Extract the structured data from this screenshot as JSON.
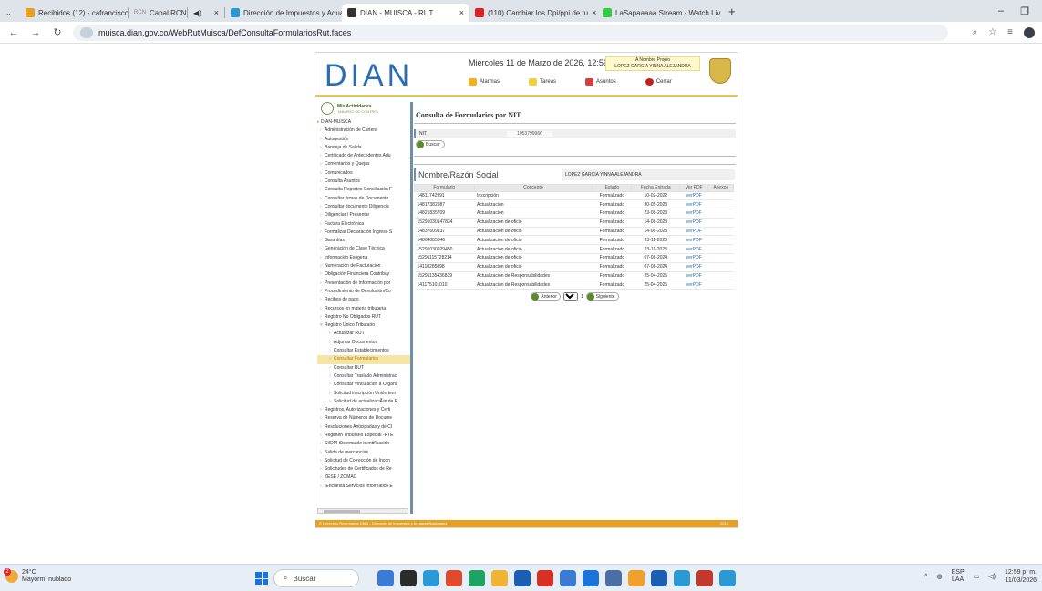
{
  "browser": {
    "tabs": [
      {
        "label": "Recibidos (12) - cafrancisco145",
        "color": "#e8a020",
        "active": false
      },
      {
        "label": "Canal RCN",
        "color": "#e0e0e0",
        "active": false
      },
      {
        "label": "",
        "color": "#e0e0e0",
        "active": false
      },
      {
        "label": "Dirección de Impuestos y Adua",
        "color": "#2a9ad6",
        "active": false
      },
      {
        "label": "DIAN - MUISCA - RUT",
        "color": "#333333",
        "active": true
      },
      {
        "label": "(110) Cambiar los Dpi/ppi de tu",
        "color": "#e02020",
        "active": false
      },
      {
        "label": "LaSapaaaaa Stream - Watch Liv",
        "color": "#2ecc40",
        "active": false
      }
    ],
    "rcn_prefix": "RCN",
    "url": "muisca.dian.gov.co/WebRutMuisca/DefConsultaFormulariosRut.faces"
  },
  "header": {
    "logo": "DIAN",
    "date": "Miércoles 11 de Marzo de 2026, 12:59:29",
    "user_title": "A Nombre Propio",
    "user_name": "LOPEZ GARCIA YINNA ALEJANDRA",
    "links": [
      {
        "label": "Alarmas",
        "color": "#f0b020"
      },
      {
        "label": "Tareas",
        "color": "#f0d040"
      },
      {
        "label": "Asuntos",
        "color": "#d04040"
      },
      {
        "label": "Cerrar",
        "color": "#c02020"
      }
    ]
  },
  "sidebar": {
    "title": "Mis Actividades",
    "subtitle": "TABLERO DE CONTROL",
    "root": "DIAN-MUISCA",
    "items": [
      "Administración de Cartera",
      "Autogestión",
      "Bandeja de Salida",
      "Certificado de Antecedentes Adu",
      "Comentarios y Quejas",
      "Comunicados",
      "Consulta Asuntos",
      "Consulta Reportes Conciliación F",
      "Consultar firmas de Documento",
      "Consultar documento Diligencia",
      "Diligenciar / Presentar",
      "Factura Electrónica",
      "Formalizar Declaración Ingreso S",
      "Garantías",
      "Generación de Clave Técnica",
      "Información Exógena",
      "Numeración de Facturación",
      "Obligación Financiera Contribuy",
      "Presentación de Información por",
      "Procedimiento de Devolución/Co",
      "Recibos de pago",
      "Recursos en materia tributaria",
      "Registro No Obligados RUT"
    ],
    "open_item": "Registro Único Tributario",
    "sub_items": [
      "Actualizar RUT",
      "Adjuntar Documentos",
      "Consultar Establecimientos",
      "Consultar Formularios",
      "Consultar RUT",
      "Consultar Traslado Administrac",
      "Consultar Vinculación a Organi",
      "Solicitud inscripción Unión tem",
      "Solicitud de actualizaciÃ³n de R"
    ],
    "highlighted": "Consultar Formularios",
    "items_after": [
      "Registros, Autorizaciones y Certi",
      "Reserva de Números de Docume",
      "Resoluciones Anticipadas y de Cl",
      "Régimen Tributario Especial -RTE",
      "SIIDPI Sistema de identificación",
      "Salida de mercancías",
      "Solicitud de Corrección de Incon",
      "Solicitudes de Certificados de Re",
      "ZESE / ZOMAC",
      "[Encuesta Servicios Informático E"
    ]
  },
  "main": {
    "title": "Consulta de Formularios por NIT",
    "nit_label": "NIT",
    "nit_value": "1053799966",
    "button_label": "Buscar",
    "rs_label": "Nombre/Razón Social",
    "rs_value": "LOPEZ GARCIA YINNA ALEJANDRA",
    "columns": [
      "Formulario",
      "Concepto",
      "Estado",
      "Fecha Entrada",
      "Ver PDF",
      "Anexos"
    ],
    "rows": [
      [
        "14811742991",
        "Inscripción",
        "Formalizado",
        "10-02-2022",
        "verPDF",
        ""
      ],
      [
        "14817382987",
        "Actualización",
        "Formalizado",
        "30-05-2023",
        "verPDF",
        ""
      ],
      [
        "14821835709",
        "Actualización",
        "Formalizado",
        "23-08-2023",
        "verPDF",
        ""
      ],
      [
        "15291030147834",
        "Actualización de oficio",
        "Formalizado",
        "14-08-2023",
        "verPDF",
        ""
      ],
      [
        "14837609137",
        "Actualización de oficio",
        "Formalizado",
        "14-08-2023",
        "verPDF",
        ""
      ],
      [
        "14864085846",
        "Actualización de oficio",
        "Formalizado",
        "23-11-2023",
        "verPDF",
        ""
      ],
      [
        "15291030929450",
        "Actualización de oficio",
        "Formalizado",
        "23-11-2023",
        "verPDF",
        ""
      ],
      [
        "15291115728214",
        "Actualización de oficio",
        "Formalizado",
        "07-08-2024",
        "verPDF",
        ""
      ],
      [
        "14110285898",
        "Actualización de oficio",
        "Formalizado",
        "07-08-2024",
        "verPDF",
        ""
      ],
      [
        "15291135436839",
        "Actualización de Responsabilidades",
        "Formalizado",
        "25-04-2025",
        "verPDF",
        ""
      ],
      [
        "141175101010",
        "Actualización de Responsabilidades",
        "Formalizado",
        "25-04-2025",
        "verPDF",
        ""
      ]
    ],
    "pager": {
      "prev": "Anterior",
      "page": "1",
      "of": "1",
      "next": "Siguiente"
    }
  },
  "footer": {
    "text": "© Derechos Reservados DIAN - Dirección de Impuestos y Aduanas Nacionales",
    "year": "2015"
  },
  "taskbar": {
    "temp": "24°C",
    "weather": "Mayorm. nublado",
    "badge": "2",
    "search": "Buscar",
    "lang1": "ESP",
    "lang2": "LAA",
    "time": "12:59 p. m.",
    "date": "11/03/2026",
    "app_colors": [
      "#3a7bd5",
      "#2b2b2b",
      "#2a9ad6",
      "#e04a2a",
      "#1ea362",
      "#f2b233",
      "#1a5fb4",
      "#d93025",
      "#3a7bd5",
      "#1a73d9",
      "#4a6fa5",
      "#f2a02c",
      "#1a5fb4",
      "#2a9ad6",
      "#c0392b",
      "#2a9ad6"
    ]
  }
}
